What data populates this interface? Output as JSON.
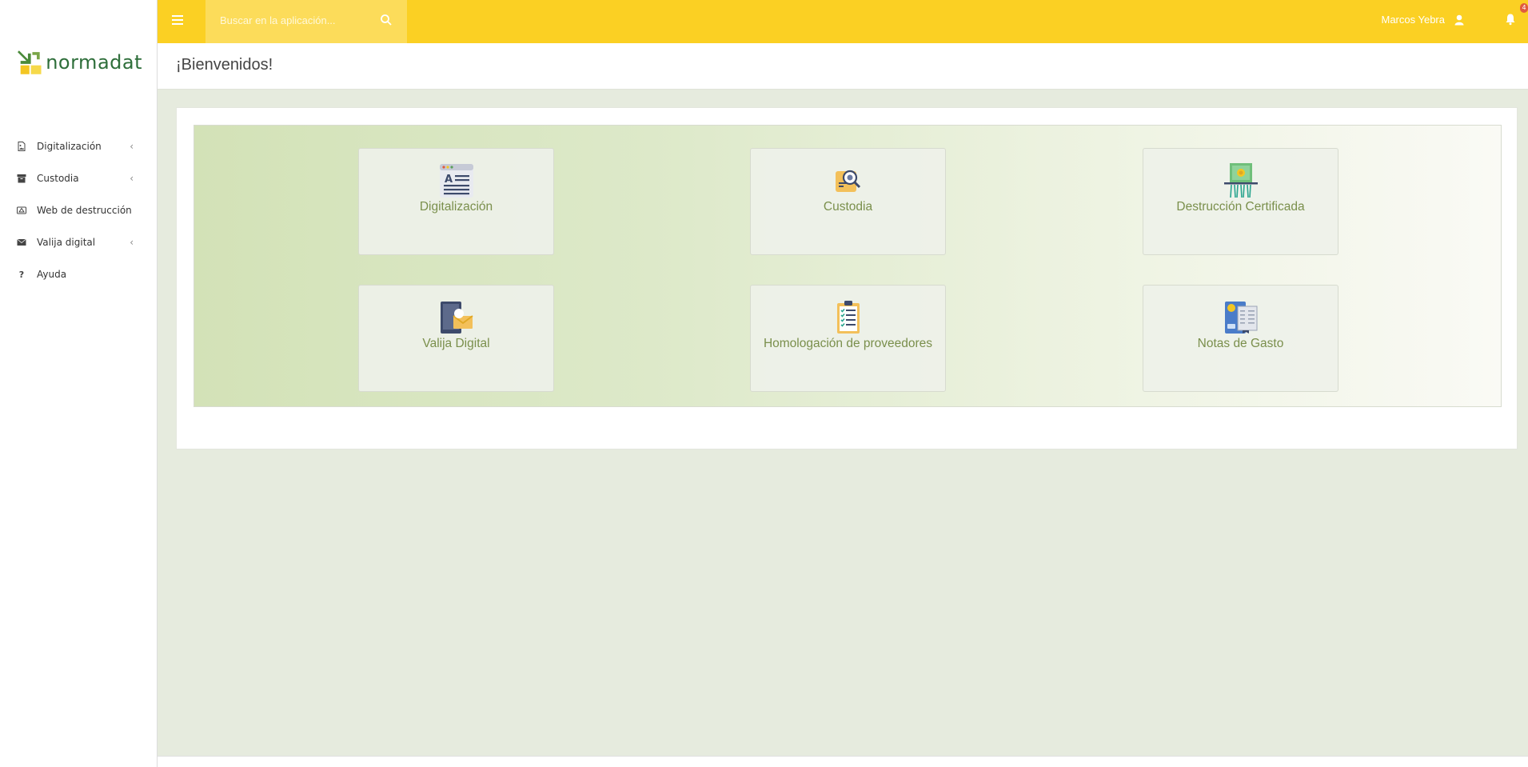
{
  "brand": {
    "name": "normadat",
    "colors": {
      "topbar": "#fbd023",
      "tile_text": "#7a8f4c",
      "brand_green": "#2e6e3a"
    }
  },
  "sidebar": {
    "items": [
      {
        "label": "Digitalización",
        "icon": "file-image-icon",
        "has_submenu": true
      },
      {
        "label": "Custodia",
        "icon": "archive-box-icon",
        "has_submenu": true
      },
      {
        "label": "Web de destrucción",
        "icon": "shredder-icon",
        "has_submenu": false
      },
      {
        "label": "Valija digital",
        "icon": "envelope-icon",
        "has_submenu": true
      },
      {
        "label": "Ayuda",
        "icon": "question-icon",
        "has_submenu": false
      }
    ]
  },
  "topbar": {
    "search": {
      "placeholder": "Buscar en la aplicación..."
    },
    "user": {
      "name": "Marcos Yebra"
    },
    "notifications": {
      "count": "4"
    }
  },
  "page": {
    "title": "¡Bienvenidos!"
  },
  "tiles": [
    {
      "label": "Digitalización",
      "icon": "document-text-icon"
    },
    {
      "label": "Custodia",
      "icon": "magnifier-folder-icon"
    },
    {
      "label": "Destrucción Certificada",
      "icon": "shredder-certificate-icon"
    },
    {
      "label": "Valija Digital",
      "icon": "tablet-envelope-icon"
    },
    {
      "label": "Homologación de proveedores",
      "icon": "clipboard-checklist-icon"
    },
    {
      "label": "Notas de Gasto",
      "icon": "receipt-card-icon"
    }
  ]
}
